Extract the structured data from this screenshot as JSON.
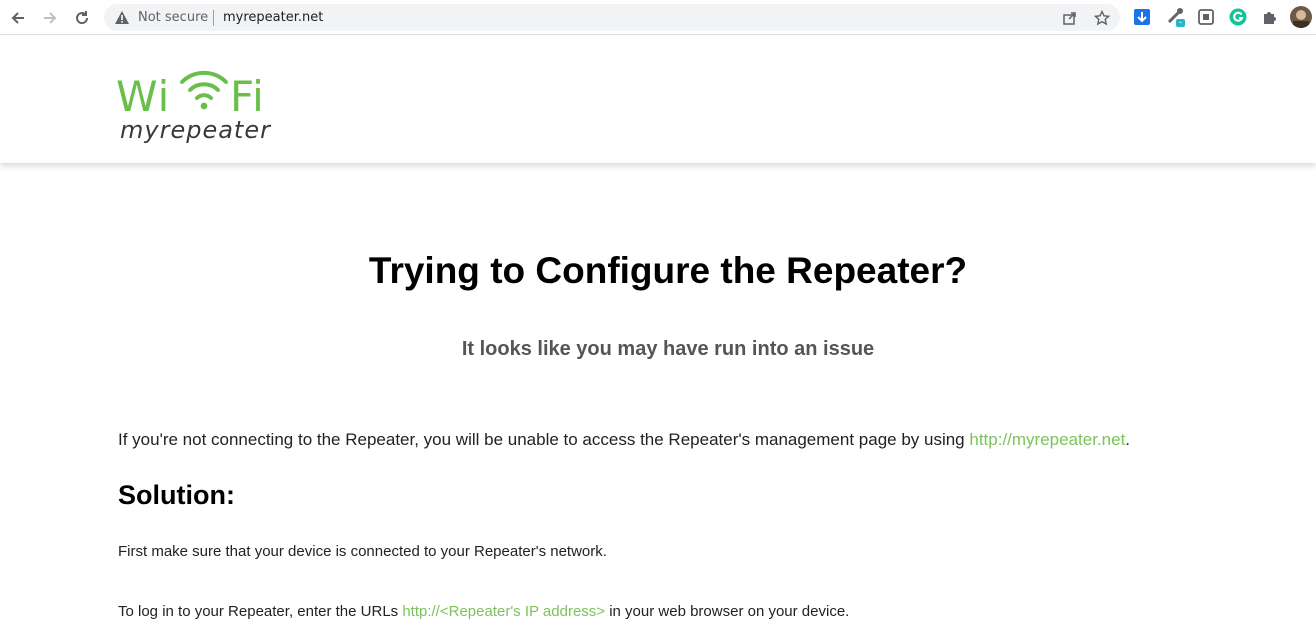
{
  "browser": {
    "security_label": "Not secure",
    "url": "myrepeater.net",
    "extension_badge": "-"
  },
  "site": {
    "logo_wifi_left": "Wi",
    "logo_wifi_right": "Fi",
    "logo_subtitle": "myrepeater",
    "brand_color": "#6abf4b"
  },
  "content": {
    "title": "Trying to Configure the Repeater?",
    "subtitle": "It looks like you may have run into an issue",
    "para1_text": "If you're not connecting to the Repeater, you will be unable to access the Repeater's management page by using ",
    "para1_link": "http://myrepeater.net",
    "para1_end": ".",
    "solution_heading": "Solution:",
    "para2": "First make sure that your device is connected to your Repeater's network.",
    "para3_text": "To log in to your Repeater, enter the URLs ",
    "para3_link": "http://<Repeater's IP address>",
    "para3_end": " in your web browser on your device."
  }
}
